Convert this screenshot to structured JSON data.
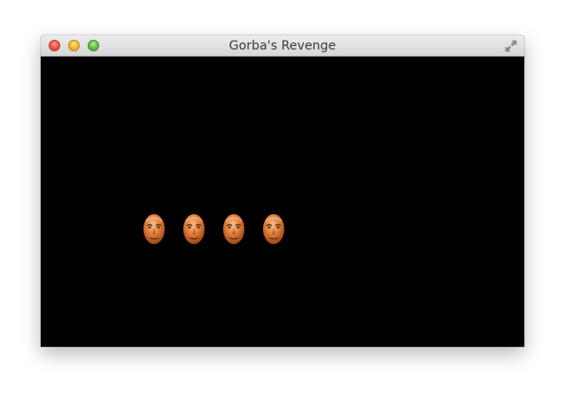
{
  "window": {
    "title": "Gorba's Revenge",
    "controls": [
      "close",
      "minimize",
      "zoom",
      "fullscreen"
    ]
  },
  "game": {
    "background": "#000000",
    "enemies": [
      {
        "type": "head-sprite"
      },
      {
        "type": "head-sprite"
      },
      {
        "type": "head-sprite"
      },
      {
        "type": "head-sprite"
      }
    ]
  },
  "colors": {
    "close": "#f45a4b",
    "minimize": "#f5bb38",
    "zoom": "#65c74a",
    "titlebar_top": "#ededed",
    "titlebar_bottom": "#d6d6d6"
  }
}
